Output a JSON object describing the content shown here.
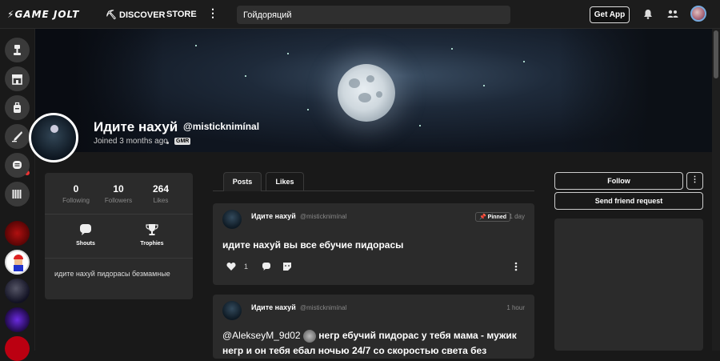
{
  "topbar": {
    "logo": "GAME JOLT",
    "discover_label": "DISCOVER",
    "store_label": "STORE",
    "more_label": "⋮",
    "search_value": "Гойдоряций",
    "get_app_label": "Get App"
  },
  "profile": {
    "name": "Идите нахуй",
    "handle": "@misticknimínal",
    "joined": "Joined 3 months ago",
    "badge": "GMR"
  },
  "stats": {
    "following_count": "0",
    "following_label": "Following",
    "followers_count": "10",
    "followers_label": "Followers",
    "likes_count": "264",
    "likes_label": "Likes",
    "shouts_label": "Shouts",
    "trophies_label": "Trophies",
    "bio": "идите нахуй пидорасы безмамные"
  },
  "tabs": [
    {
      "label": "Posts",
      "active": true
    },
    {
      "label": "Likes",
      "active": false
    }
  ],
  "posts": [
    {
      "author": "Идите нахуй",
      "handle": "@misticknimínal",
      "pinned_label": "Pinned",
      "time": "1 day",
      "text": "идите нахуй вы все ебучие пидорасы",
      "likes": "1"
    },
    {
      "author": "Идите нахуй",
      "handle": "@misticknimínal",
      "time": "1 hour",
      "text_line1_mention": "@AlekseyM_9d02",
      "text_line1": "негр ебучий пидорас у тебя мама - мужик",
      "text_line2": "негр и он тебя ебал ночью 24/7 со скоростью света без"
    }
  ],
  "right": {
    "follow_label": "Follow",
    "follow_more_label": "⋮",
    "send_friend_label": "Send friend request"
  },
  "colors": {
    "background": "#191919",
    "card": "#2b2b2b",
    "notification_dot": "#e33333"
  }
}
